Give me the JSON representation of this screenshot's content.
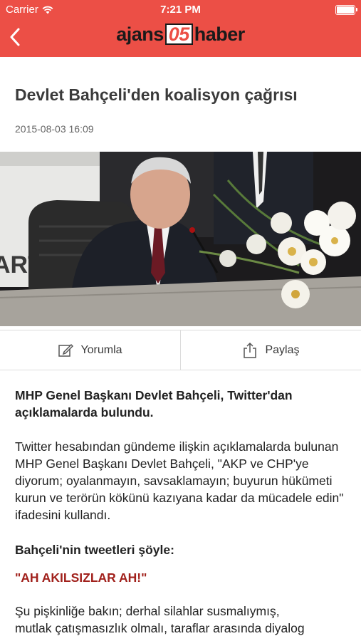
{
  "status_bar": {
    "carrier": "Carrier",
    "time": "7:21 PM"
  },
  "header": {
    "back_icon": "chevron-left-icon",
    "logo_left": "ajans",
    "logo_box": "05",
    "logo_right": "haber",
    "bar_color": "#ec4f46"
  },
  "article": {
    "title": "Devlet Bahçeli'den koalisyon çağrısı",
    "date": "2015-08-03 16:09",
    "lead": "MHP Genel Başkanı Devlet Bahçeli, Twitter'dan açıklamalarda bulundu.",
    "paragraph": "Twitter hesabından gündeme ilişkin açıklamalarda bulunan MHP Genel Başkanı Devlet Bahçeli, \"AKP ve CHP'ye diyorum; oyalanmayın, savsaklamayın; buyurun hükümeti kurun ve terörün kökünü kazıyana kadar da mücadele edin\" ifadesini kullandı.",
    "subhead": "Bahçeli'nin tweetleri şöyle:",
    "quote": "\"AH AKILSIZLAR AH!\"",
    "paragraph2_line1": "Şu pişkinliğe bakın; derhal silahlar susmalıymış,",
    "paragraph2_line2": "mutlak çatışmasızlık olmalı, taraflar arasında diyalog",
    "quote_color": "#a1211c"
  },
  "actions": {
    "comment_label": "Yorumla",
    "comment_icon": "edit-icon",
    "share_label": "Paylaş",
    "share_icon": "share-icon"
  }
}
